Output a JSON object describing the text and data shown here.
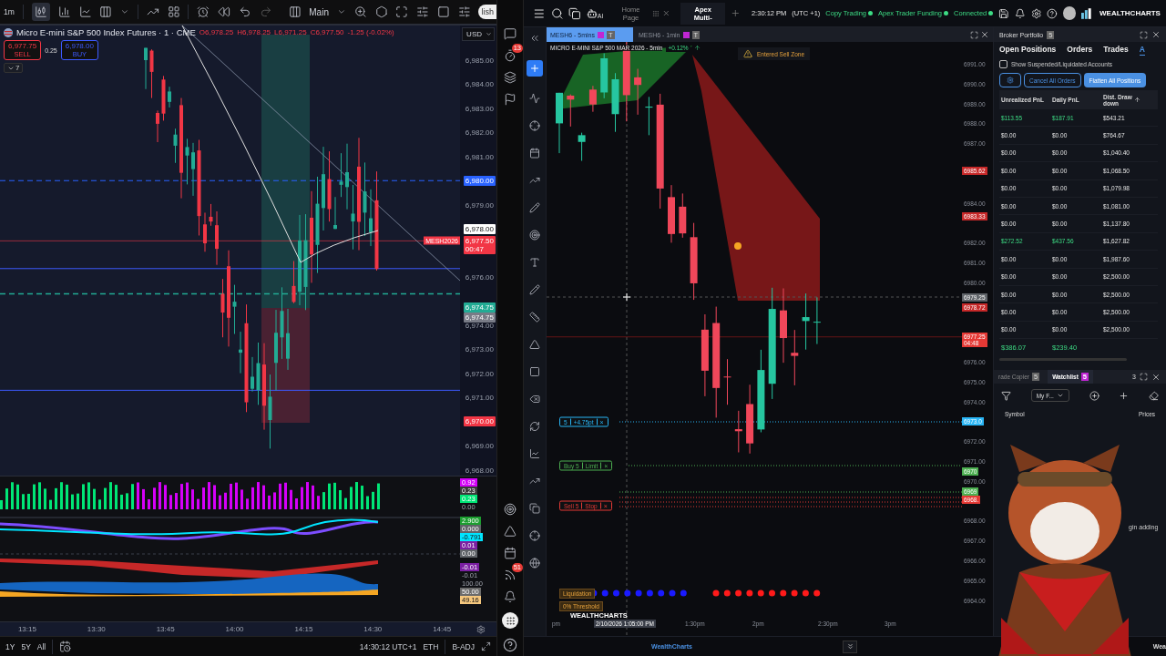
{
  "left_chart": {
    "toolbar": {
      "interval": "1m",
      "layout": "Main",
      "publish": "lish"
    },
    "legend": {
      "title": "Micro E-mini S&P 500 Index Futures · 1 · CME",
      "open": "O6,978.25",
      "high": "H6,978.25",
      "low": "L6,971.25",
      "close": "C6,977.50",
      "change": "-1.25 (-0.02%)"
    },
    "currency": "USD",
    "trade": {
      "sell_price": "6,977.75",
      "sell_label": "SELL",
      "spread": "0.25",
      "buy_price": "6,978.00",
      "buy_label": "BUY",
      "collapse": "7"
    },
    "price_ticks": [
      "6,985.00",
      "6,984.00",
      "6,983.00",
      "6,982.00",
      "6,981.00",
      "6,979.00",
      "6,976.00",
      "6,974.00",
      "6,973.00",
      "6,972.00",
      "6,971.00",
      "6,969.00",
      "6,968.00"
    ],
    "price_badges": [
      {
        "text": "6,980.00",
        "color": "#2962ff"
      },
      {
        "text": "6,978.00",
        "color": "#ffffff"
      },
      {
        "text": "6,977.50",
        "sub": "00:47",
        "color": "#f23645"
      },
      {
        "text": "6,974.75",
        "color": "#22ab94"
      },
      {
        "text": "6,974.75",
        "color": "#787b86"
      },
      {
        "text": "6,970.00",
        "color": "#f23645"
      }
    ],
    "symbol_tag": "MESH2026",
    "indicator_badges": [
      [
        {
          "text": "0.92",
          "color": "#d500f9"
        },
        {
          "text": "0.23",
          "color": "#3a3a3a"
        },
        {
          "text": "0.23",
          "color": "#00e676"
        },
        {
          "text": "0.00"
        }
      ],
      [
        {
          "text": "2.900",
          "color": "#1b9e2f"
        },
        {
          "text": "0.000",
          "color": "#5f6368"
        },
        {
          "text": "-0.791",
          "color": "#00e5ff"
        },
        {
          "text": "0.01",
          "color": "#7b1fa2"
        },
        {
          "text": "0.00",
          "color": "#5f6368"
        }
      ],
      [
        {
          "text": "-0.01",
          "color": "#7b1fa2"
        },
        {
          "text": "-0.01"
        },
        {
          "text": "100.00"
        },
        {
          "text": "50.00",
          "color": "#6b6b6b"
        },
        {
          "text": "49.16",
          "color": "#f5c77e"
        }
      ]
    ],
    "time_ticks": [
      "13:15",
      "13:30",
      "13:45",
      "14:00",
      "14:15",
      "14:30",
      "14:45"
    ],
    "ranges": [
      "1Y",
      "5Y",
      "All"
    ],
    "clock": "14:30:12 UTC+1",
    "session": "ETH",
    "adjust": "B-ADJ"
  },
  "side_strip": {
    "alerts_badge": "13",
    "feed_badge": "51"
  },
  "top_bar": {
    "ai_label": "AI",
    "tabs": [
      {
        "label": "Home Page",
        "selected": false
      },
      {
        "label": "Apex Multi-",
        "selected": true
      }
    ],
    "time": "2:30:12 PM",
    "timezone": "(UTC +1)",
    "statuses": [
      "Copy Trading",
      "Apex Trader Funding",
      "Connected"
    ],
    "logo": "WEALTHCHARTS"
  },
  "right_chart": {
    "tabs": [
      {
        "label": "MESH6 - 5mins",
        "badge": "T",
        "selected": true
      },
      {
        "label": "MESH6 - 1min",
        "badge": "T",
        "selected": false
      }
    ],
    "legend": "MICRO E-MINI S&P 500 MAR 2026 - 5min",
    "change": "+0.12%",
    "alert": "Entered Sell Zone",
    "price_ticks": [
      "6991.00",
      "6990.00",
      "6989.00",
      "6988.00",
      "6987.00",
      "6984.00",
      "6982.00",
      "6981.00",
      "6980.00",
      "6976.00",
      "6975.00",
      "6974.00",
      "6972.00",
      "6971.00",
      "6970.00",
      "6968.00",
      "6967.00",
      "6966.00",
      "6965.00",
      "6964.00"
    ],
    "price_badges": [
      {
        "text": "6985.62",
        "color": "#c62828"
      },
      {
        "text": "6983.33",
        "color": "#c62828"
      },
      {
        "text": "6979.25",
        "color": "#5f6368"
      },
      {
        "text": "6978.72",
        "color": "#c62828"
      },
      {
        "text": "6977.25",
        "sub": "04:48",
        "color": "#e53935"
      },
      {
        "text": "6973.0",
        "color": "#29b6f6"
      },
      {
        "text": "6970",
        "color": "#4caf50"
      },
      {
        "text": "6969",
        "color": "#4caf50"
      },
      {
        "text": "6968.",
        "color": "#e53935"
      }
    ],
    "orders": [
      {
        "kind": "position",
        "parts": [
          "5",
          "+4.75pt"
        ],
        "close": "×"
      },
      {
        "kind": "buy",
        "parts": [
          "Buy 5",
          "Limit"
        ],
        "close": "×"
      },
      {
        "kind": "sell",
        "parts": [
          "Sell 5",
          "Stop"
        ],
        "close": "×"
      }
    ],
    "liquidation": "Liquidation",
    "threshold": "0% Threshold",
    "chart_logo": "WEALTHCHARTS",
    "crosshair_time": "2/10/2026 1:05:00 PM",
    "time_ticks": [
      "pm",
      "1:30pm",
      "2pm",
      "2:30pm",
      "3pm"
    ]
  },
  "portfolio": {
    "title": "Broker Portfolio",
    "badge": "5",
    "tabs": [
      {
        "label": "Open Positions",
        "selected": false
      },
      {
        "label": "Orders",
        "selected": false
      },
      {
        "label": "Trades",
        "selected": false
      },
      {
        "label": "A",
        "selected": true
      }
    ],
    "show_suspended": {
      "label": "Show Suspended/Liquidated Accounts",
      "checked": false
    },
    "buttons": [
      "Cancel All Orders",
      "Flatten All Positions"
    ],
    "columns": [
      "Unrealized PnL",
      "Daily PnL",
      "Dist. Drawdown"
    ],
    "rows": [
      {
        "cells": [
          "$113.55",
          "$187.91",
          "$543.21"
        ],
        "profit": true
      },
      {
        "cells": [
          "$0.00",
          "$0.00",
          "$764.67"
        ],
        "profit": false
      },
      {
        "cells": [
          "$0.00",
          "$0.00",
          "$1,040.40"
        ],
        "profit": false
      },
      {
        "cells": [
          "$0.00",
          "$0.00",
          "$1,068.50"
        ],
        "profit": false
      },
      {
        "cells": [
          "$0.00",
          "$0.00",
          "$1,079.98"
        ],
        "profit": false
      },
      {
        "cells": [
          "$0.00",
          "$0.00",
          "$1,081.00"
        ],
        "profit": false
      },
      {
        "cells": [
          "$0.00",
          "$0.00",
          "$1,137.80"
        ],
        "profit": false
      },
      {
        "cells": [
          "$272.52",
          "$437.56",
          "$1,627.82"
        ],
        "profit": true
      },
      {
        "cells": [
          "$0.00",
          "$0.00",
          "$1,987.60"
        ],
        "profit": false
      },
      {
        "cells": [
          "$0.00",
          "$0.00",
          "$2,500.00"
        ],
        "profit": false
      },
      {
        "cells": [
          "$0.00",
          "$0.00",
          "$2,500.00"
        ],
        "profit": false
      },
      {
        "cells": [
          "$0.00",
          "$0.00",
          "$2,500.00"
        ],
        "profit": false
      },
      {
        "cells": [
          "$0.00",
          "$0.00",
          "$2,500.00"
        ],
        "profit": false
      }
    ],
    "totals": [
      "$386.07",
      "$239.40"
    ]
  },
  "watchlist": {
    "tabs": [
      {
        "label": "rade Copier",
        "badge": "5",
        "selected": false
      },
      {
        "label": "Watchlist",
        "badge": "5",
        "selected": true
      }
    ],
    "count": "3",
    "list": "My F...",
    "columns": [
      "Symbol",
      "Prices"
    ],
    "note": "gin adding"
  },
  "footer": {
    "brand": "WealthCharts",
    "right": "Wea"
  }
}
